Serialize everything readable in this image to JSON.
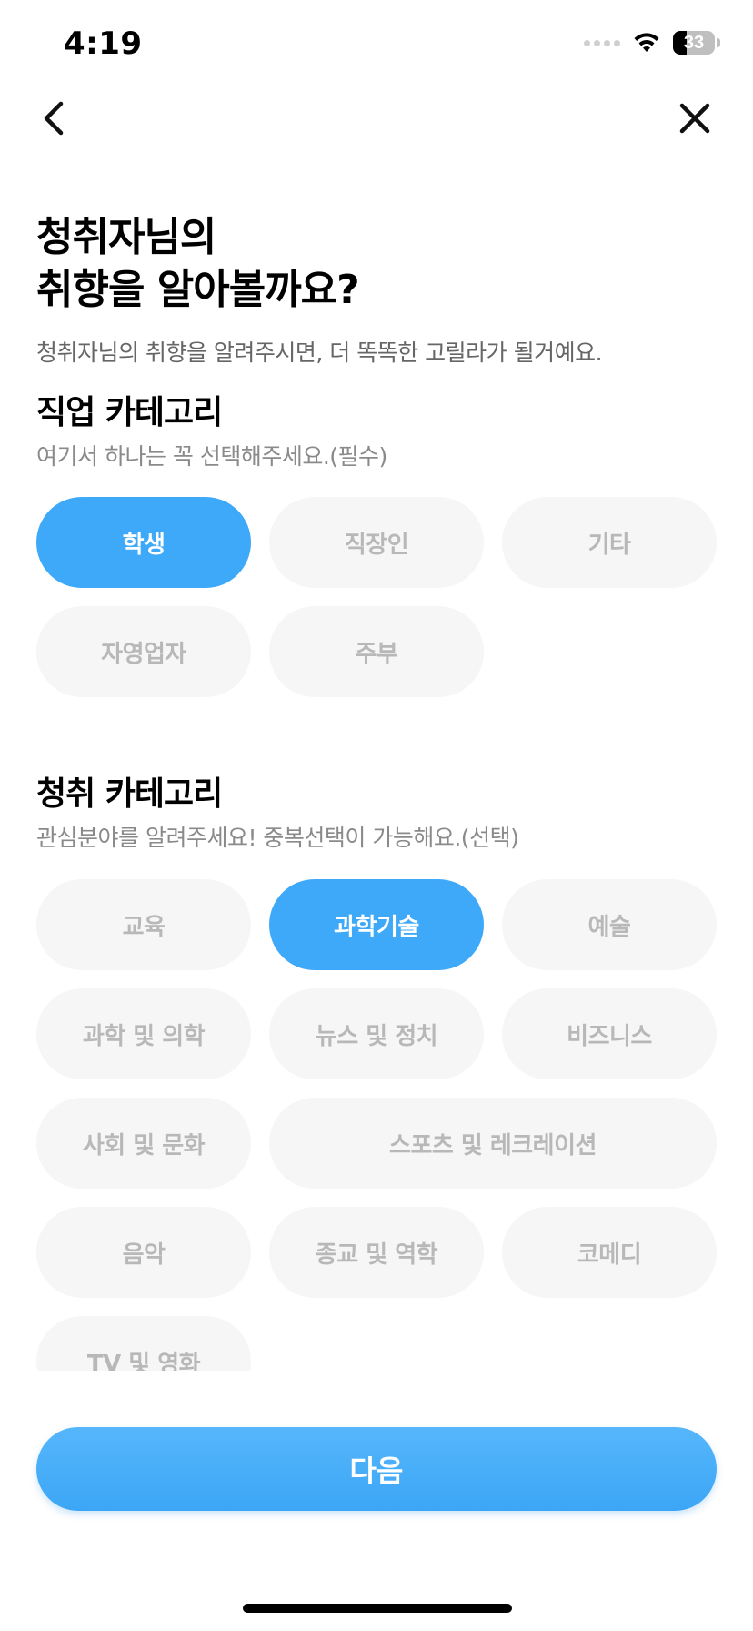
{
  "status_bar": {
    "time": "4:19",
    "battery_level": "33",
    "battery_fraction": 0.33
  },
  "nav": {
    "back_icon": "chevron-left-icon",
    "close_icon": "close-icon"
  },
  "headline": {
    "line1": "청취자님의",
    "line2": "취향을 알아볼까요?"
  },
  "subtitle": "청취자님의 취향을 알려주시면, 더 똑똑한 고릴라가 될거예요.",
  "job_section": {
    "title": "직업 카테고리",
    "hint": "여기서 하나는 꼭 선택해주세요.(필수)",
    "options": [
      {
        "label": "학생",
        "selected": true
      },
      {
        "label": "직장인",
        "selected": false
      },
      {
        "label": "기타",
        "selected": false
      },
      {
        "label": "자영업자",
        "selected": false
      },
      {
        "label": "주부",
        "selected": false
      }
    ]
  },
  "listen_section": {
    "title": "청취 카테고리",
    "hint": "관심분야를 알려주세요! 중복선택이 가능해요.(선택)",
    "options": [
      {
        "label": "교육",
        "selected": false
      },
      {
        "label": "과학기술",
        "selected": true
      },
      {
        "label": "예술",
        "selected": false
      },
      {
        "label": "과학 및 의학",
        "selected": false
      },
      {
        "label": "뉴스 및 정치",
        "selected": false
      },
      {
        "label": "비즈니스",
        "selected": false
      },
      {
        "label": "사회 및 문화",
        "selected": false
      },
      {
        "label": "스포츠 및 레크레이션",
        "selected": false
      },
      {
        "label": "음악",
        "selected": false
      },
      {
        "label": "종교 및 역학",
        "selected": false
      },
      {
        "label": "코메디",
        "selected": false
      },
      {
        "label": "TV 및 영화",
        "selected": false
      }
    ]
  },
  "next_button": {
    "label": "다음"
  },
  "colors": {
    "accent": "#3ea9f8",
    "chip_bg": "#f6f6f6",
    "chip_text": "#b8b8b8"
  }
}
